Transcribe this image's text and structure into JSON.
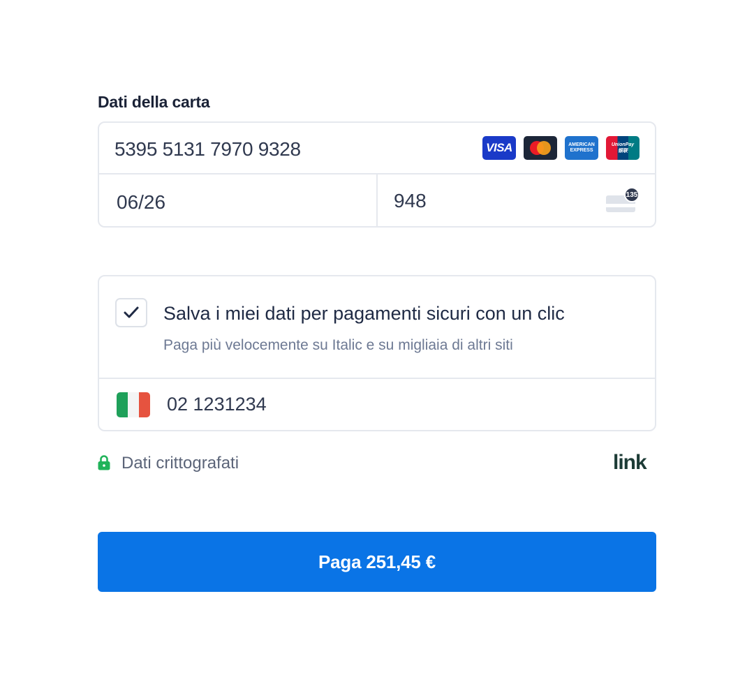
{
  "card_section": {
    "label": "Dati della carta",
    "card_number": "5395 5131 7970 9328",
    "expiry": "06/26",
    "cvc": "948",
    "cvc_hint": "135",
    "brands": [
      {
        "name": "visa",
        "label": "VISA"
      },
      {
        "name": "mastercard",
        "label": ""
      },
      {
        "name": "amex",
        "label_line1": "AMERICAN",
        "label_line2": "EXPRESS"
      },
      {
        "name": "unionpay",
        "label_line1": "UnionPay",
        "label_line2": "银联"
      }
    ]
  },
  "link_save": {
    "checked": true,
    "title": "Salva i miei dati per pagamenti sicuri con un clic",
    "subtitle": "Paga più velocemente su Italic e su migliaia di altri siti",
    "phone": "02 1231234",
    "country_flag": "it-flag-icon"
  },
  "footer": {
    "secure_text": "Dati crittografati",
    "brand_logo": "link"
  },
  "pay_button": {
    "label": "Paga 251,45 €"
  },
  "colors": {
    "primary": "#0a74e6",
    "lock_green": "#21b35a",
    "border": "#e5e8ee",
    "text_dark": "#1f2a44",
    "text_muted": "#6d7993"
  }
}
